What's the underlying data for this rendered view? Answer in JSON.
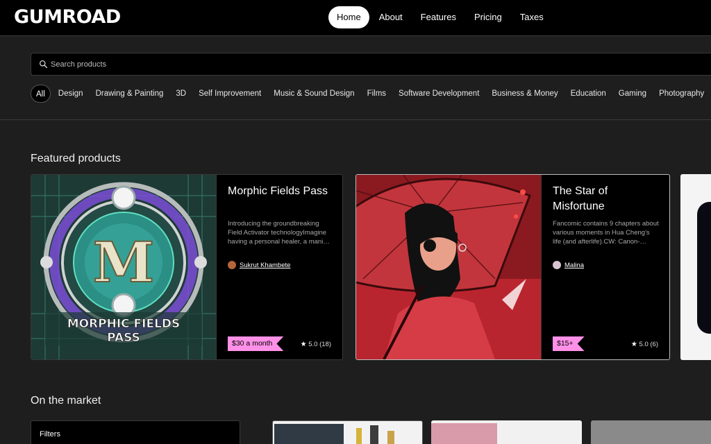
{
  "header": {
    "logo": "GUMROAD",
    "nav": [
      {
        "label": "Home",
        "active": true
      },
      {
        "label": "About",
        "active": false
      },
      {
        "label": "Features",
        "active": false
      },
      {
        "label": "Pricing",
        "active": false
      },
      {
        "label": "Taxes",
        "active": false
      }
    ]
  },
  "search": {
    "placeholder": "Search products",
    "value": ""
  },
  "categories": [
    "All",
    "Design",
    "Drawing & Painting",
    "3D",
    "Self Improvement",
    "Music & Sound Design",
    "Films",
    "Software Development",
    "Business & Money",
    "Education",
    "Gaming",
    "Photography"
  ],
  "featured": {
    "title": "Featured products",
    "products": [
      {
        "title": "Morphic Fields Pass",
        "description": "Introducing the groundbreaking Field Activator technologyImagine having a personal healer, a mani…",
        "creator": "Sukrut Khambete",
        "price": "$30 a month",
        "rating": "5.0 (18)",
        "image_text": "MORPHIC FIELDS PASS",
        "image_letter": "M"
      },
      {
        "title": "The Star of Misfortune",
        "description": "Fancomic contains 9 chapters about various moments in Hua Cheng's life (and afterlife).CW: Canon-…",
        "creator": "Malina",
        "price": "$15+",
        "rating": "5.0 (6)"
      }
    ]
  },
  "market": {
    "title": "On the market",
    "filters_label": "Filters"
  },
  "colors": {
    "accent": "#ff90e8",
    "background": "#1e1e1e",
    "card": "#000000"
  }
}
